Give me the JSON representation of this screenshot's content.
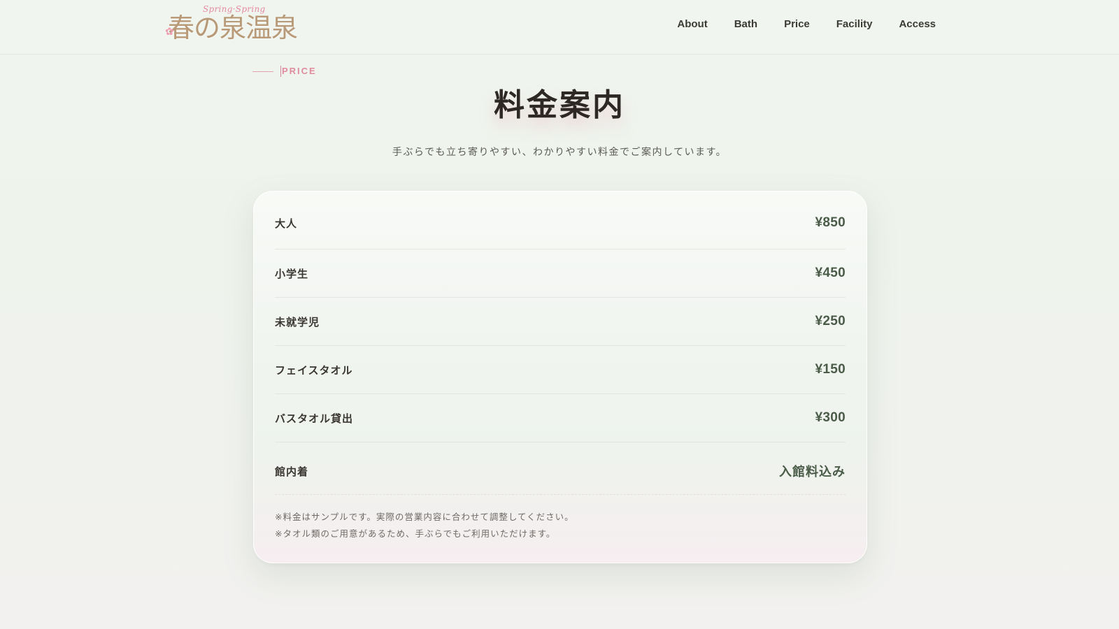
{
  "header": {
    "logo": {
      "subtitle": "Spring·Spring",
      "title": "春の泉温泉",
      "flower": "✿"
    },
    "nav": [
      {
        "label": "About"
      },
      {
        "label": "Bath"
      },
      {
        "label": "Price"
      },
      {
        "label": "Facility"
      },
      {
        "label": "Access"
      }
    ]
  },
  "section": {
    "eyebrow": "PRICE",
    "title": "料金案内",
    "lead": "手ぶらでも立ち寄りやすい、わかりやすい料金でご案内しています。"
  },
  "prices": [
    {
      "label": "大人",
      "value": "¥850"
    },
    {
      "label": "小学生",
      "value": "¥450"
    },
    {
      "label": "未就学児",
      "value": "¥250"
    },
    {
      "label": "フェイスタオル",
      "value": "¥150"
    },
    {
      "label": "バスタオル貸出",
      "value": "¥300"
    },
    {
      "label": "館内着",
      "value": "入館料込み"
    }
  ],
  "notes": [
    "※料金はサンプルです。実際の営業内容に合わせて調整してください。",
    "※タオル類のご用意があるため、手ぶらでもご利用いただけます。"
  ],
  "colors": {
    "accent_pink": "#e08c9c",
    "price_green": "#4a5c48",
    "background": "#f1f5f0"
  }
}
